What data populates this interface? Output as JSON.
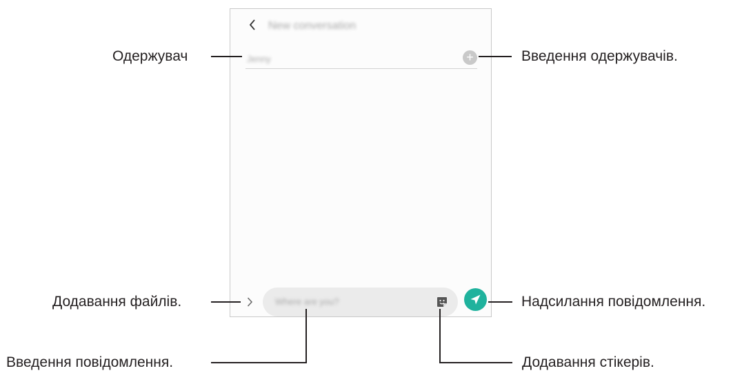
{
  "screen": {
    "title": "New conversation",
    "recipient_value": "Jenny",
    "compose_placeholder": "Where are you?",
    "icons": {
      "back": "chevron-left-icon",
      "add_recipient": "plus-circle-icon",
      "attach": "chevron-right-icon",
      "sticker": "sticker-icon",
      "send": "paper-plane-icon"
    },
    "colors": {
      "send_button": "#1fb29d",
      "compose_field": "#ebebeb",
      "add_icon": "#c9c9c9"
    }
  },
  "callouts": {
    "recipient": "Одержувач",
    "enter_recipients": "Введення одержувачів.",
    "attach_files": "Додавання файлів.",
    "send_message": "Надсилання повідомлення.",
    "enter_message": "Введення повідомлення.",
    "add_stickers": "Додавання стікерів."
  }
}
